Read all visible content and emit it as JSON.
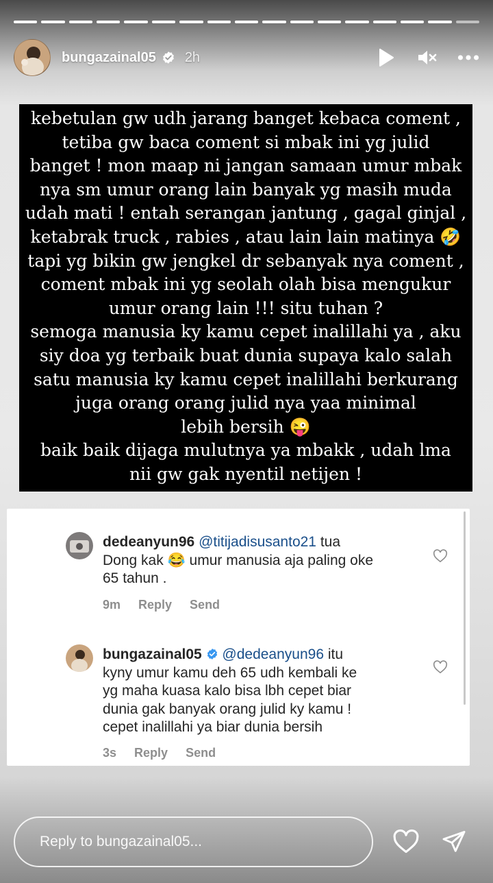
{
  "story": {
    "segments_total": 17,
    "segments_viewed": 16,
    "username": "bungazainal05",
    "time_ago": "2h"
  },
  "icons": {
    "play": "play-icon",
    "mute": "speaker-muted-icon",
    "more": "more-horizontal-icon",
    "verified": "verified-badge-icon",
    "heart": "heart-icon",
    "send": "send-icon"
  },
  "post_text_lines": [
    "kebetulan gw udh jarang banget kebaca coment ,",
    "tetiba gw baca coment si mbak ini yg julid",
    "banget ! mon maap ni jangan samaan umur mbak",
    "nya sm umur  orang lain banyak yg masih muda",
    "udah mati ! entah serangan jantung , gagal ginjal ,",
    "ketabrak truck , rabies , atau lain lain matinya 🤣",
    "tapi yg bikin gw jengkel dr sebanyak nya coment ,",
    "coment mbak ini yg seolah olah bisa mengukur",
    "umur orang lain !!! situ tuhan ?",
    "semoga manusia ky kamu cepet inalillahi ya , aku",
    "siy doa yg terbaik buat dunia supaya kalo salah",
    "satu manusia ky kamu cepet inalillahi berkurang",
    "juga orang orang julid nya yaa minimal",
    "lebih bersih 😜",
    "baik baik dijaga mulutnya ya mbakk , udah lma",
    "nii gw gak nyentil netijen !"
  ],
  "comments": [
    {
      "user": "dedeanyun96",
      "mention": "@titijadisusanto21",
      "lines": [
        "tua",
        "Dong kak 😂 umur manusia aja paling oke",
        "65 tahun ."
      ],
      "time": "9m",
      "reply": "Reply",
      "send": "Send"
    },
    {
      "user": "bungazainal05",
      "mention": "@dedeanyun96",
      "lines": [
        "itu",
        "kyny umur kamu deh 65 udh kembali ke",
        "yg maha kuasa kalo bisa lbh cepet biar",
        "dunia gak banyak orang julid ky kamu !",
        "cepet inalillahi ya biar dunia bersih"
      ],
      "time": "3s",
      "reply": "Reply",
      "send": "Send"
    }
  ],
  "reply_bar": {
    "placeholder": "Reply to bungazainal05..."
  },
  "colors": {
    "verified": "#ffffff",
    "mention": "#1a4f8a",
    "meta": "#8e8e8e"
  }
}
